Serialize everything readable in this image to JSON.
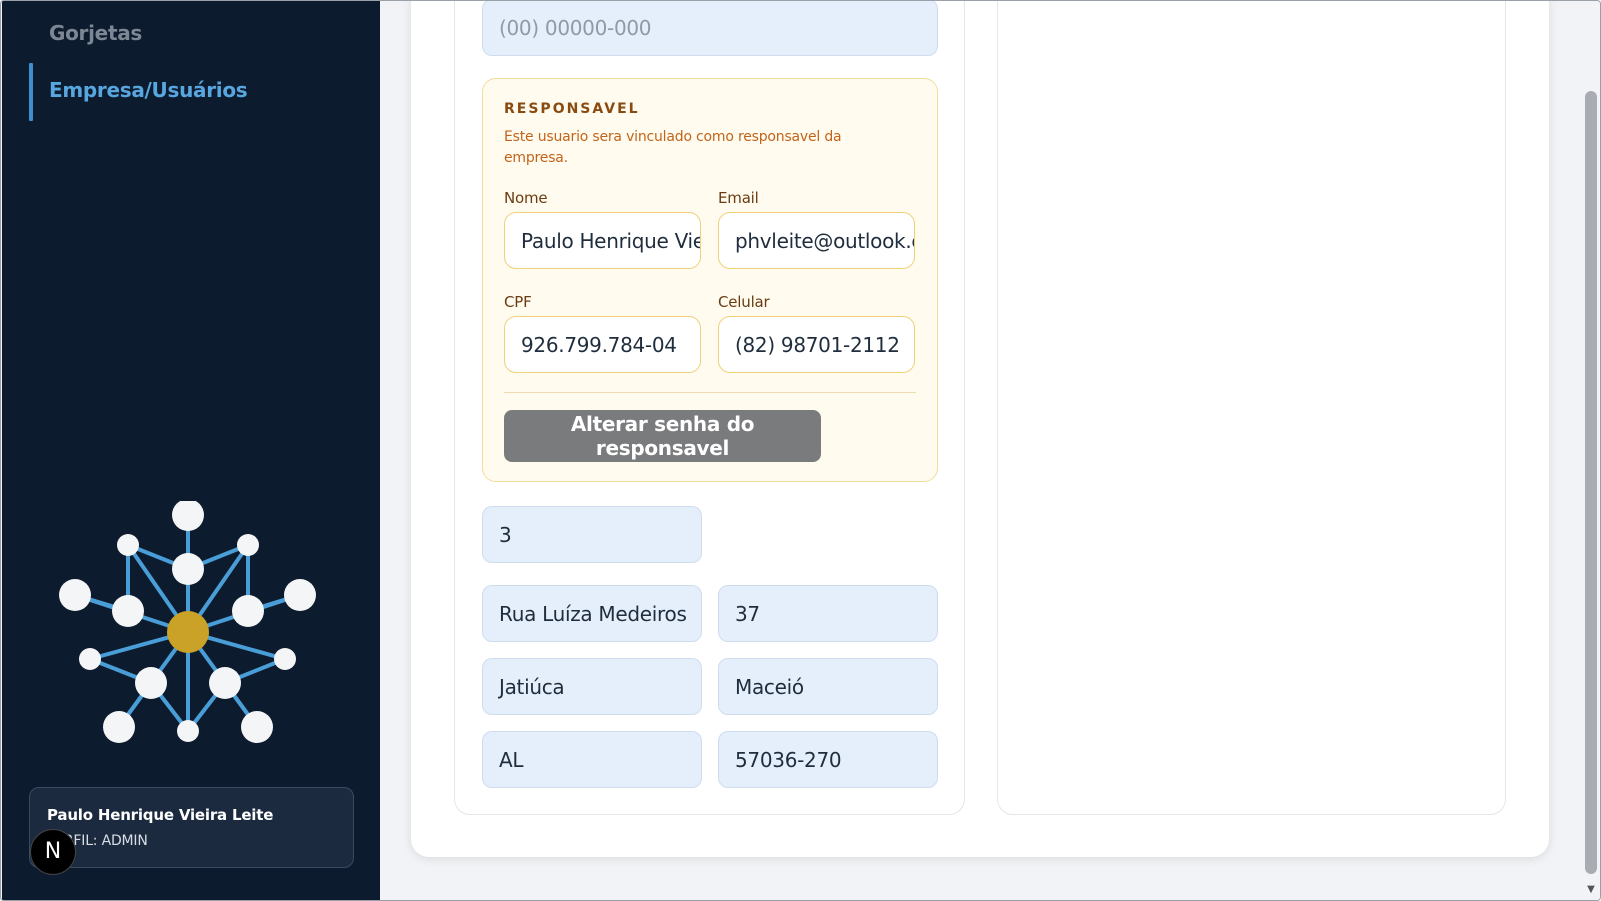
{
  "sidebar": {
    "nav": [
      {
        "label": "Gorjetas"
      },
      {
        "label": "Empresa/Usuários"
      }
    ],
    "user": {
      "name": "Paulo Henrique Vieira Leite",
      "role": "PERFIL: ADMIN"
    },
    "badge": "N"
  },
  "form": {
    "phone_placeholder": "(00) 00000-000",
    "responsavel": {
      "title": "RESPONSAVEL",
      "description": "Este usuario sera vinculado como responsavel da empresa.",
      "name_label": "Nome",
      "name_value": "Paulo Henrique Vieira Leite",
      "email_label": "Email",
      "email_value": "phvleite@outlook.com",
      "cpf_label": "CPF",
      "cpf_value": "926.799.784-04",
      "celular_label": "Celular",
      "celular_value": "(82) 98701-2112",
      "change_password_button": "Alterar senha do responsavel"
    },
    "count_value": "3",
    "street_value": "Rua Luíza Medeiros",
    "number_value": "37",
    "neighborhood_value": "Jatiúca",
    "city_value": "Maceió",
    "state_value": "AL",
    "cep_value": "57036-270"
  },
  "colors": {
    "sidebar_bg": "#0d1b2e",
    "accent_blue": "#58a6df",
    "logo_gold": "#c9a227",
    "responsavel_bg": "#fffbef",
    "responsavel_border": "#f3dc9c"
  }
}
